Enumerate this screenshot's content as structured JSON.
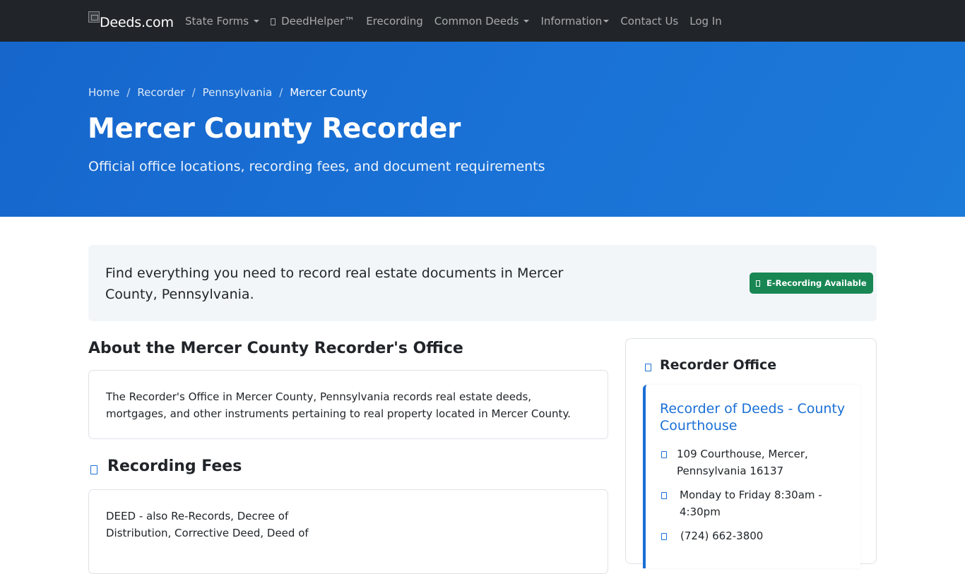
{
  "navbar": {
    "brand_alt": "Deeds.com",
    "items": [
      {
        "label": "State Forms",
        "dropdown": true,
        "icon": ""
      },
      {
        "label": "DeedHelper™",
        "dropdown": false,
        "icon": "sparkle-icon"
      },
      {
        "label": "Erecording",
        "dropdown": false,
        "icon": ""
      },
      {
        "label": "Common Deeds",
        "dropdown": true,
        "icon": ""
      },
      {
        "label": "Information",
        "dropdown": true,
        "icon": ""
      },
      {
        "label": "Contact Us",
        "dropdown": false,
        "icon": ""
      },
      {
        "label": "Log In",
        "dropdown": false,
        "icon": ""
      }
    ]
  },
  "breadcrumb": {
    "items": [
      "Home",
      "Recorder",
      "Pennsylvania",
      "Mercer County"
    ],
    "separator": "/"
  },
  "hero": {
    "title": "Mercer County Recorder",
    "subtitle": "Official office locations, recording fees, and document requirements"
  },
  "intro": {
    "text": "Find everything you need to record real estate documents in Mercer County, Pennsylvania.",
    "badge_label": "E-Recording Available"
  },
  "about": {
    "heading": "About the Mercer County Recorder's Office",
    "text": "The Recorder's Office in Mercer County, Pennsylvania records real estate deeds, mortgages, and other instruments pertaining to real property located in Mercer County."
  },
  "fees": {
    "heading": "Recording Fees",
    "text_line1": "DEED - also Re-Records, Decree of",
    "text_line2": "Distribution, Corrective Deed, Deed of"
  },
  "sidebar": {
    "title": "Recorder Office",
    "office_name": "Recorder of Deeds - County Courthouse",
    "address": "109 Courthouse, Mercer, Pennsylvania 16137",
    "hours": "Monday to Friday 8:30am - 4:30pm",
    "phone": "(724) 662-3800"
  },
  "colors": {
    "navbar_bg": "#212529",
    "hero_bg": "#1a6fd6",
    "badge_bg": "#198754",
    "accent": "#1a6fd6"
  }
}
